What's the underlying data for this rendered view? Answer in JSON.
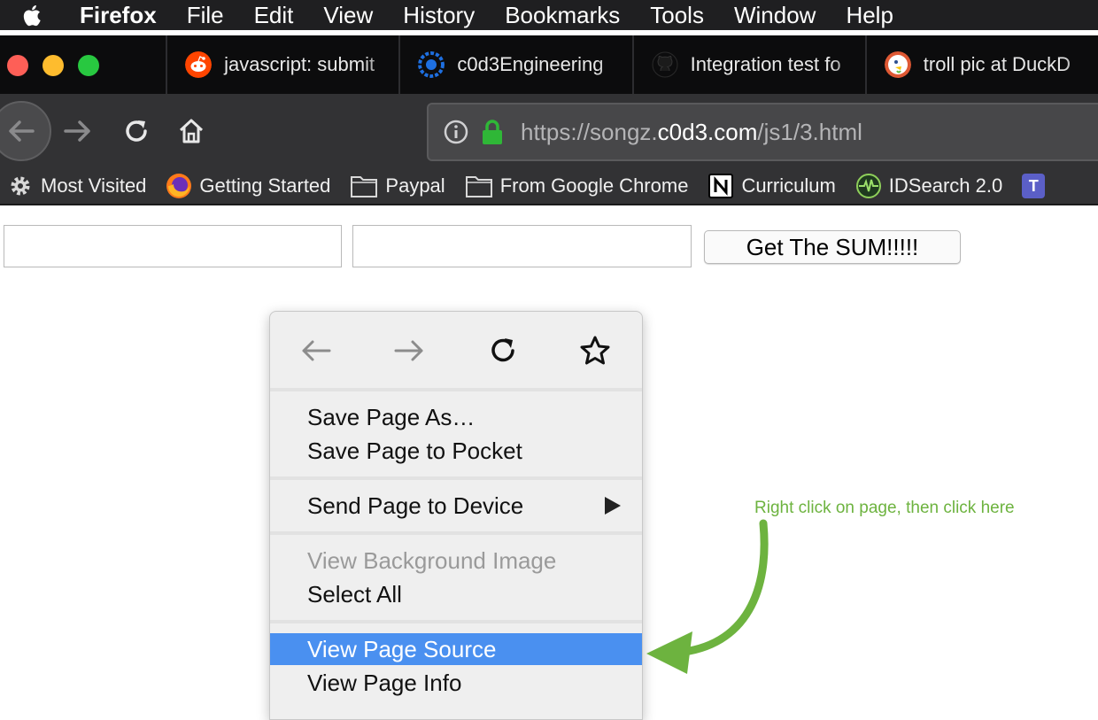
{
  "menubar": {
    "app": "Firefox",
    "items": [
      "File",
      "Edit",
      "View",
      "History",
      "Bookmarks",
      "Tools",
      "Window",
      "Help"
    ]
  },
  "tabs": [
    {
      "title": "javascript: submit",
      "icon": "reddit-icon"
    },
    {
      "title": "c0d3Engineering",
      "icon": "c0d3-icon"
    },
    {
      "title": "Integration test fo",
      "icon": "github-icon"
    },
    {
      "title": "troll pic at DuckD",
      "icon": "duckduckgo-icon"
    }
  ],
  "urlbar": {
    "url_prefix": "https://songz.",
    "url_host": "c0d3.com",
    "url_path": "/js1/3.html"
  },
  "bookmarks": [
    {
      "label": "Most Visited",
      "icon": "gear-icon"
    },
    {
      "label": "Getting Started",
      "icon": "firefox-icon"
    },
    {
      "label": "Paypal",
      "icon": "folder-icon"
    },
    {
      "label": "From Google Chrome",
      "icon": "folder-icon"
    },
    {
      "label": "Curriculum",
      "icon": "notion-icon"
    },
    {
      "label": "IDSearch 2.0",
      "icon": "idsearch-icon"
    },
    {
      "label": "T",
      "icon": "teams-icon"
    }
  ],
  "page": {
    "input1_value": "",
    "input2_value": "",
    "sum_button": "Get The SUM!!!!!"
  },
  "context_menu": {
    "items": [
      {
        "label": "Save Page As…"
      },
      {
        "label": "Save Page to Pocket"
      },
      {
        "label": "Send Page to Device",
        "submenu": true
      },
      {
        "label": "View Background Image",
        "disabled": true
      },
      {
        "label": "Select All"
      },
      {
        "label": "View Page Source",
        "selected": true
      },
      {
        "label": "View Page Info"
      }
    ]
  },
  "annotation": {
    "text": "Right click on page, then click here",
    "color": "#6db33f"
  },
  "colors": {
    "selection": "#4a90f0",
    "lock": "#2fb737",
    "menubar_bg": "#1f1f21",
    "toolbar_bg": "#323234"
  }
}
